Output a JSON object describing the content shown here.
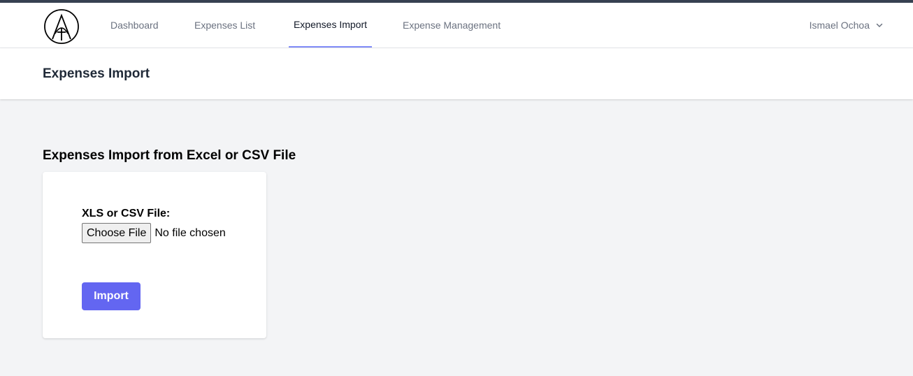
{
  "nav": {
    "items": [
      {
        "label": "Dashboard",
        "active": false
      },
      {
        "label": "Expenses List",
        "active": false
      },
      {
        "label": "Expenses Import",
        "active": true
      },
      {
        "label": "Expense Management",
        "active": false
      }
    ],
    "user_name": "Ismael Ochoa",
    "logo_icon": "compass-cross-logo-icon",
    "accent_color": "#818cf8"
  },
  "header": {
    "title": "Expenses Import"
  },
  "main": {
    "section_title": "Expenses Import from Excel or CSV File",
    "form": {
      "file_label": "XLS or CSV File:",
      "choose_button": "Choose File",
      "file_status": "No file chosen",
      "submit_label": "Import",
      "submit_color": "#6366f1"
    }
  }
}
